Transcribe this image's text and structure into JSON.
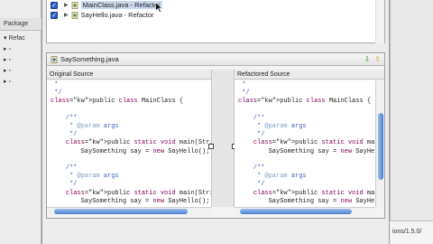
{
  "workbench": {
    "package_tab": "Package",
    "tree_item": "Refac",
    "status_path": "ions/1.5.0/"
  },
  "changes": [
    {
      "label": "MainClass.java - Refactor",
      "selected": true
    },
    {
      "label": "SayHello.java - Refactor",
      "selected": false
    }
  ],
  "compare": {
    "title": "SaySomething.java",
    "left_header": "Original Source",
    "right_header": "Refactored Source",
    "left_lines": [
      " *",
      " */",
      "public class MainClass {",
      "",
      "    /**",
      "     * @param args",
      "     */",
      "    public static void main(String[] args)",
      "        SaySomething say = new SayHello();",
      "",
      "    /**",
      "     * @param args",
      "     */",
      "    public static void main(String[] args)",
      "        SaySomething say = new SayHello();"
    ],
    "right_lines": [
      " *",
      " */",
      "public class MainClass {",
      "",
      "    /**",
      "     * @param args",
      "     */",
      "    public static void main(String[] args",
      "        SaySomething say = new SayHello",
      "",
      "    /**",
      "     * @param args",
      "     */",
      "    public static void main(String[] args",
      "        SaySomething say = new SayHello"
    ]
  }
}
